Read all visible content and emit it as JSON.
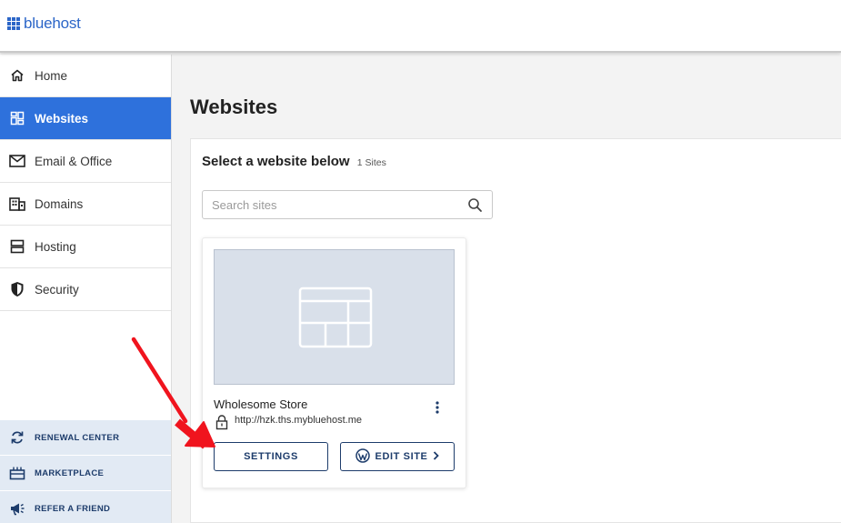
{
  "brand": {
    "name": "bluehost",
    "color": "#2c66c8"
  },
  "sidebar": {
    "items": [
      {
        "label": "Home",
        "icon": "home-icon",
        "active": false
      },
      {
        "label": "Websites",
        "icon": "websites-grid-icon",
        "active": true
      },
      {
        "label": "Email & Office",
        "icon": "envelope-icon",
        "active": false
      },
      {
        "label": "Domains",
        "icon": "building-icon",
        "active": false
      },
      {
        "label": "Hosting",
        "icon": "server-icon",
        "active": false
      },
      {
        "label": "Security",
        "icon": "shield-icon",
        "active": false
      }
    ],
    "bottom_links": [
      {
        "label": "RENEWAL CENTER",
        "icon": "renew-icon"
      },
      {
        "label": "MARKETPLACE",
        "icon": "gift-box-icon"
      },
      {
        "label": "REFER A FRIEND",
        "icon": "megaphone-icon"
      }
    ],
    "active_color": "#2e71dc"
  },
  "main": {
    "title": "Websites",
    "panel_title": "Select a website below",
    "site_count": "1 Sites",
    "search": {
      "placeholder": "Search sites",
      "value": ""
    },
    "site": {
      "name": "Wholesome Store",
      "url": "http://hzk.ths.mybluehost.me",
      "settings_label": "SETTINGS",
      "edit_label": "EDIT SITE"
    }
  },
  "annotation": {
    "arrow_color": "#f0141e"
  }
}
